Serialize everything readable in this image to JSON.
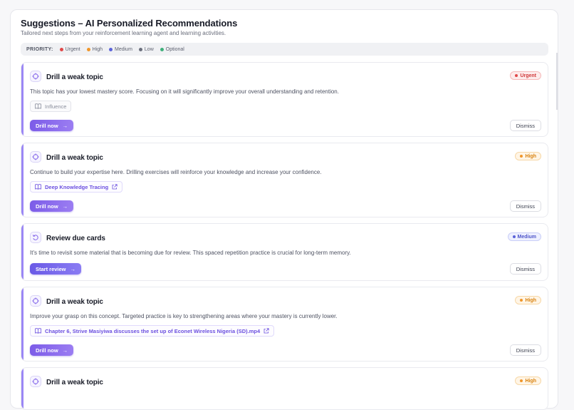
{
  "header": {
    "title": "Suggestions – AI Personalized Recommendations",
    "subtitle": "Tailored next steps from your reinforcement learning agent and learning activities."
  },
  "priority_legend": {
    "label": "PRIORITY:",
    "items": [
      {
        "label": "Urgent",
        "color": "#e04848"
      },
      {
        "label": "High",
        "color": "#f0962a"
      },
      {
        "label": "Medium",
        "color": "#5b63d9"
      },
      {
        "label": "Low",
        "color": "#6b6f7d"
      },
      {
        "label": "Optional",
        "color": "#3fb07a"
      }
    ]
  },
  "colors": {
    "accent": "#9b87f5",
    "primary_button": "#7c5ce8"
  },
  "cards": [
    {
      "icon": "target-icon",
      "title": "Drill a weak topic",
      "priority": "Urgent",
      "description": "This topic has your lowest mastery score. Focusing on it will significantly improve your overall understanding and retention.",
      "source": "Influence",
      "action": "Drill now",
      "dismiss": "Dismiss"
    },
    {
      "icon": "target-icon",
      "title": "Drill a weak topic",
      "priority": "High",
      "description": "Continue to build your expertise here. Drilling exercises will reinforce your knowledge and increase your confidence.",
      "source": "Deep Knowledge Tracing",
      "action": "Drill now",
      "dismiss": "Dismiss"
    },
    {
      "icon": "refresh-icon",
      "title": "Review due cards",
      "priority": "Medium",
      "description": "It's time to revisit some material that is becoming due for review. This spaced repetition practice is crucial for long-term memory.",
      "action": "Start review",
      "dismiss": "Dismiss"
    },
    {
      "icon": "target-icon",
      "title": "Drill a weak topic",
      "priority": "High",
      "description": "Improve your grasp on this concept. Targeted practice is key to strengthening areas where your mastery is currently lower.",
      "source": "Chapter 6, Strive Masiyiwa discusses the set up of Econet Wireless Nigeria (SD).mp4",
      "action": "Drill now",
      "dismiss": "Dismiss"
    },
    {
      "icon": "target-icon",
      "title": "Drill a weak topic",
      "priority": "High"
    }
  ]
}
